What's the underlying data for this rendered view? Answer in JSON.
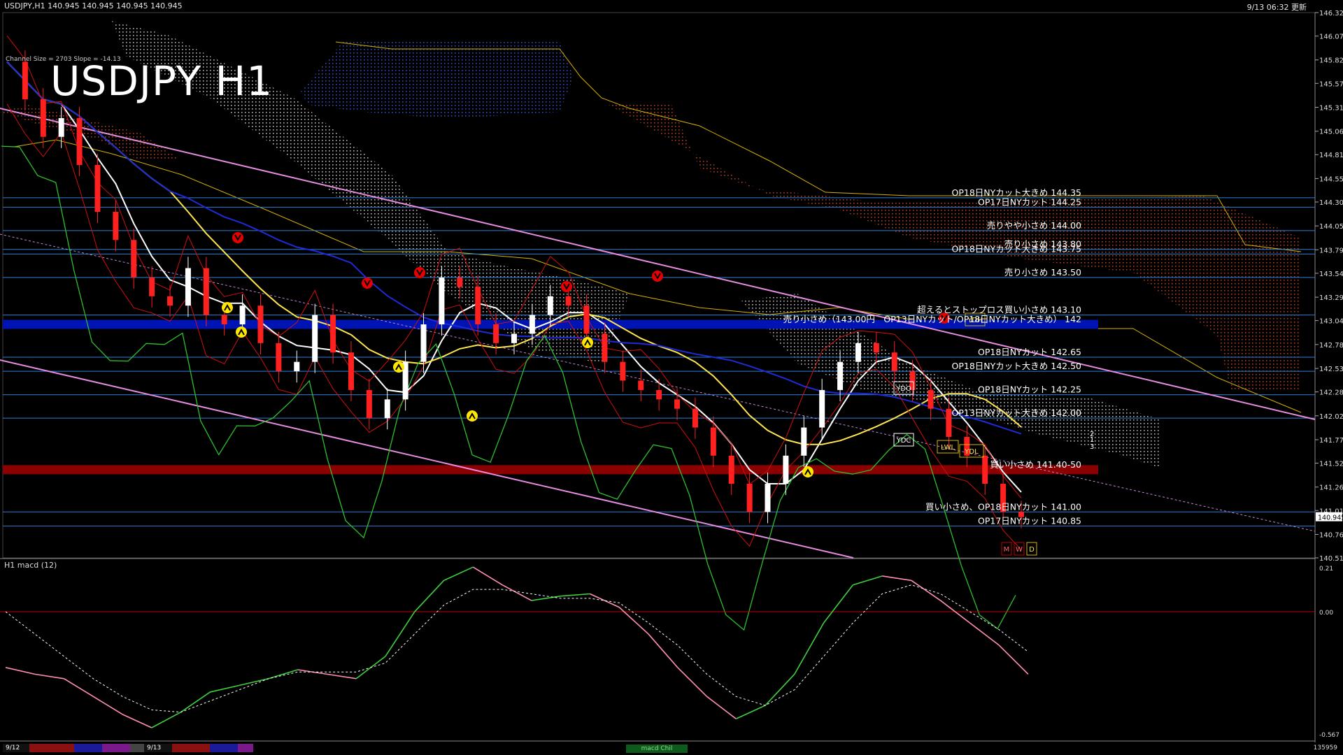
{
  "header": {
    "symbol_line": "USDJPY,H1  140.945 140.945 140.945 140.945",
    "update_text": "9/13 06:32 更新",
    "big_title": "USDJPY H1",
    "channel_info": "Channel Size = 2703 Slope = -14.13"
  },
  "price_axis_labels": [
    "146.325",
    "146.075",
    "145.820",
    "145.570",
    "145.315",
    "145.060",
    "144.810",
    "144.555",
    "144.305",
    "144.050",
    "143.795",
    "143.545",
    "143.290",
    "143.040",
    "142.785",
    "142.530",
    "142.280",
    "142.025",
    "141.770",
    "141.520",
    "141.265",
    "141.015",
    "140.760",
    "140.510"
  ],
  "current_price": "140.945",
  "level_labels": [
    "OP18日NYカット大きめ 144.35",
    "OP17日NYカット 144.25",
    "売りやや小さめ 144.00",
    "売り小さめ 143.80",
    "OP18日NYカット大きめ 143.75",
    "売り小さめ 143.50",
    "超えるとストップロス買い小さめ 143.10",
    "売り小さめ（143.00円　OP13日NYカット/OP18日NYカット大きめ） 142",
    "OP18日NYカット 142.65",
    "OP18日NYカット大きめ 142.50",
    "OP18日NYカット 142.25",
    "OP13日NYカット大きめ 142.00",
    "買い小さめ 141.40-50",
    "買い小さめ、OP18日NYカット 141.00",
    "OP17日NYカット 140.85"
  ],
  "box_labels": [
    "YDH",
    "YDO",
    "YDC",
    "YDL",
    "LWL",
    "M",
    "W",
    "D",
    "1",
    "2",
    "3"
  ],
  "macd": {
    "title": "H1  macd (12)",
    "axis_labels": [
      "0.21",
      "0.00",
      "-0.567"
    ]
  },
  "footer": {
    "date_labels": [
      "9/12",
      "9/13"
    ],
    "macd_tag": "macd Chil",
    "volume": "135959"
  },
  "colors": {
    "background": "#000000",
    "red_cloud": "#c8461e",
    "blue_cloud": "#3b55d9",
    "white_cloud": "#cfcfcf",
    "macd_rise": "#3fd13f",
    "macd_fall": "#ff8fb3",
    "zero_line": "#c00000"
  },
  "chart_data": {
    "type": "line",
    "title": "USDJPY H1",
    "ylim": [
      140.51,
      146.325
    ],
    "price_ticks": [
      146.325,
      146.075,
      145.82,
      145.57,
      145.315,
      145.06,
      144.81,
      144.555,
      144.305,
      144.05,
      143.795,
      143.545,
      143.29,
      143.04,
      142.785,
      142.53,
      142.28,
      142.025,
      141.77,
      141.52,
      141.265,
      141.015,
      140.76,
      140.51
    ],
    "levels": [
      144.35,
      144.25,
      144.0,
      143.8,
      143.75,
      143.5,
      143.1,
      143.0,
      142.65,
      142.5,
      142.25,
      142.0,
      141.45,
      141.0,
      140.85
    ],
    "closes": [
      145.8,
      145.4,
      145.0,
      145.2,
      144.7,
      144.2,
      143.9,
      143.5,
      143.3,
      143.2,
      143.6,
      143.1,
      143.0,
      143.2,
      142.8,
      142.5,
      142.6,
      143.1,
      142.7,
      142.3,
      142.0,
      142.2,
      142.6,
      143.0,
      143.5,
      143.4,
      143.0,
      142.8,
      142.9,
      143.1,
      143.3,
      143.2,
      142.9,
      142.6,
      142.4,
      142.3,
      142.2,
      142.1,
      141.9,
      141.6,
      141.3,
      141.0,
      141.3,
      141.6,
      141.9,
      142.3,
      142.6,
      142.8,
      142.7,
      142.5,
      142.3,
      142.1,
      141.8,
      141.6,
      141.3,
      141.0,
      140.945
    ],
    "macd_line": [
      -0.25,
      -0.28,
      -0.3,
      -0.38,
      -0.46,
      -0.52,
      -0.45,
      -0.36,
      -0.33,
      -0.3,
      -0.26,
      -0.28,
      -0.3,
      -0.2,
      0.0,
      0.14,
      0.2,
      0.12,
      0.05,
      0.07,
      0.08,
      0.02,
      -0.1,
      -0.25,
      -0.38,
      -0.48,
      -0.42,
      -0.28,
      -0.05,
      0.12,
      0.16,
      0.14,
      0.05,
      -0.05,
      -0.15,
      -0.28
    ],
    "macd_signal": [
      0.0,
      -0.1,
      -0.2,
      -0.3,
      -0.38,
      -0.44,
      -0.45,
      -0.4,
      -0.35,
      -0.3,
      -0.27,
      -0.27,
      -0.27,
      -0.23,
      -0.1,
      0.03,
      0.1,
      0.1,
      0.08,
      0.06,
      0.06,
      0.04,
      -0.05,
      -0.15,
      -0.28,
      -0.38,
      -0.42,
      -0.35,
      -0.2,
      -0.05,
      0.08,
      0.12,
      0.08,
      0.0,
      -0.08,
      -0.18
    ]
  }
}
